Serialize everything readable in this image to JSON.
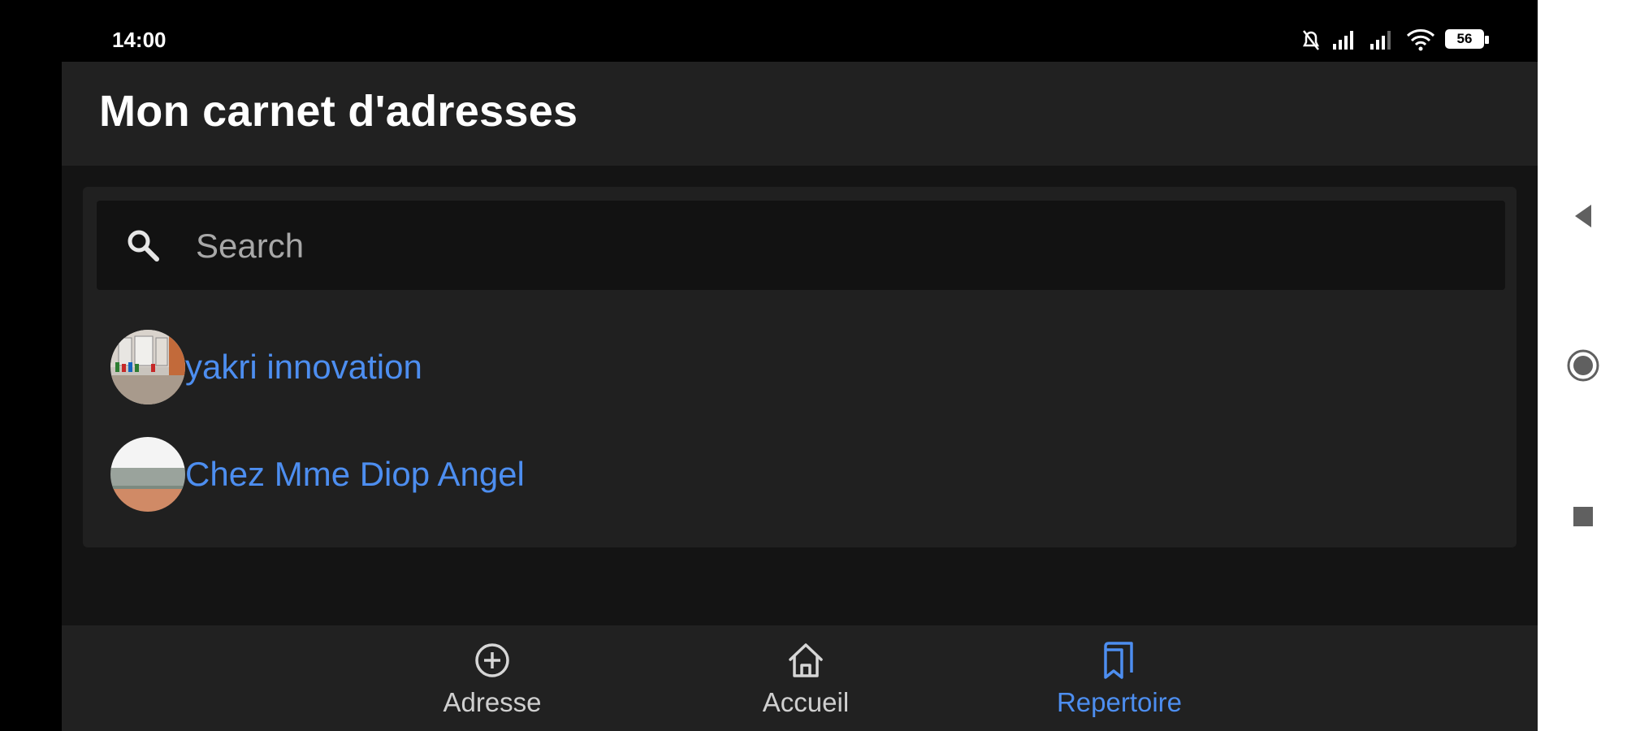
{
  "status_bar": {
    "time": "14:00",
    "battery": "56",
    "icons": [
      "mute-icon",
      "signal-icon",
      "signal-icon",
      "wifi-icon",
      "battery-icon"
    ]
  },
  "app_bar": {
    "title": "Mon carnet d'adresses"
  },
  "search": {
    "placeholder": "Search",
    "value": "",
    "icon": "search-icon"
  },
  "contacts": [
    {
      "name": "yakri innovation"
    },
    {
      "name": "Chez Mme Diop Angel"
    }
  ],
  "bottom_nav": {
    "items": [
      {
        "label": "Adresse",
        "icon": "add-circle-icon",
        "active": false
      },
      {
        "label": "Accueil",
        "icon": "home-icon",
        "active": false
      },
      {
        "label": "Repertoire",
        "icon": "bookmarks-icon",
        "active": true
      }
    ]
  },
  "system_nav": {
    "buttons": [
      "back-icon",
      "home-circle-icon",
      "recents-square-icon"
    ]
  },
  "colors": {
    "accent": "#4d8ef0",
    "app_bar": "#212121",
    "card": "#202020",
    "background": "#141414"
  }
}
